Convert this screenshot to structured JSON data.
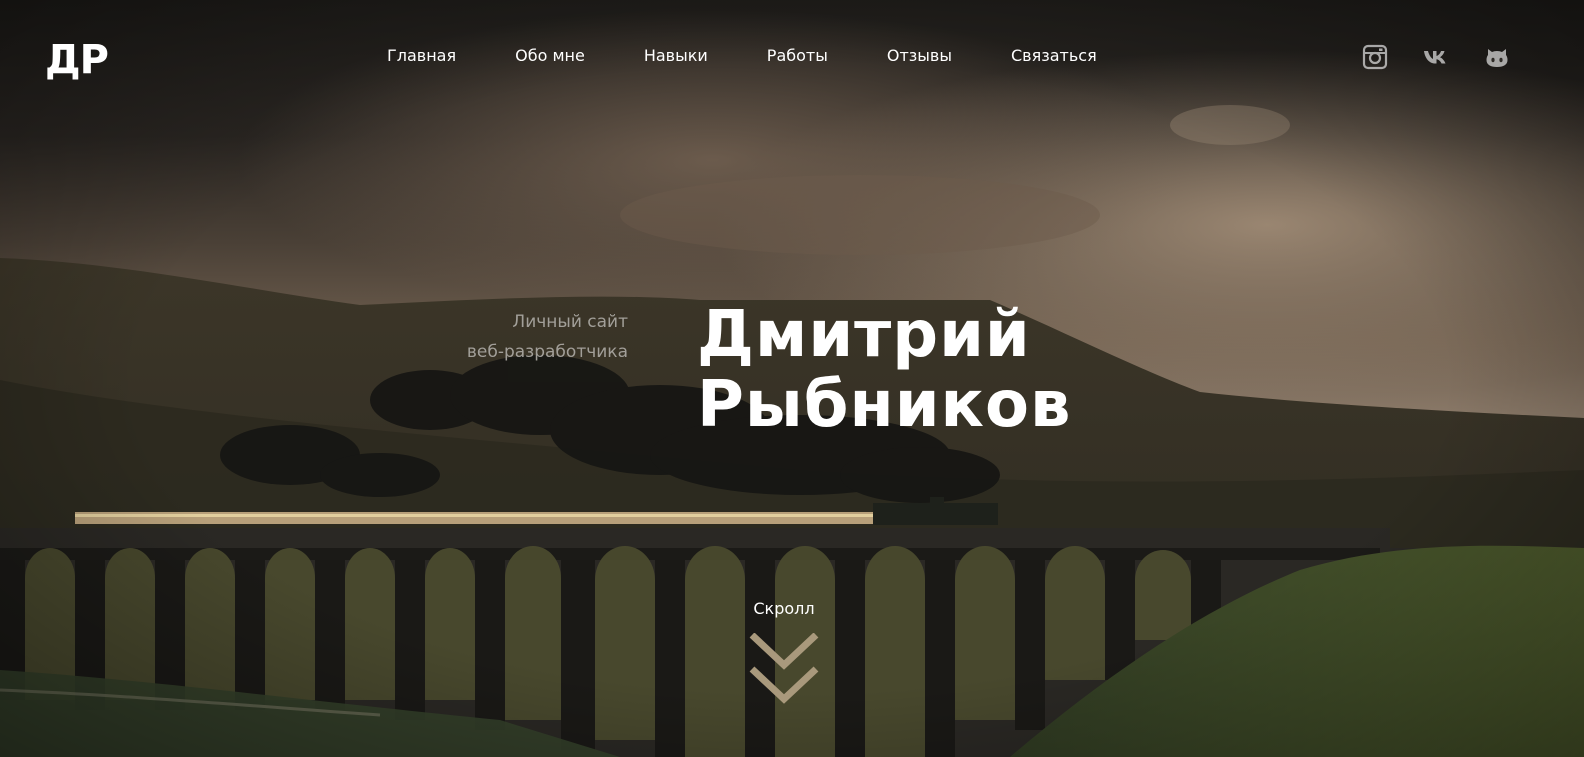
{
  "logo": {
    "text": "ДР"
  },
  "nav": {
    "items": [
      {
        "label": "Главная"
      },
      {
        "label": "Обо мне"
      },
      {
        "label": "Навыки"
      },
      {
        "label": "Работы"
      },
      {
        "label": "Отзывы"
      },
      {
        "label": "Связаться"
      }
    ]
  },
  "social": {
    "items": [
      {
        "icon": "instagram-icon"
      },
      {
        "icon": "vk-icon"
      },
      {
        "icon": "github-icon"
      }
    ]
  },
  "hero": {
    "subtitle_line1": "Личный сайт",
    "subtitle_line2": "веб-разработчика",
    "name_line1": "Дмитрий",
    "name_line2": "Рыбников"
  },
  "scroll": {
    "label": "Скролл",
    "icon": "double-chevron-down-icon"
  },
  "colors": {
    "text": "#ffffff",
    "subtitle": "#a29f99",
    "accent": "#a9997c",
    "icons": "#9e9e9e"
  }
}
